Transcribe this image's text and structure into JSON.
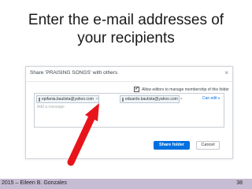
{
  "slide": {
    "title_line1": "Enter the e-mail addresses of",
    "title_line2": "your recipients"
  },
  "dialog": {
    "title": "Share 'PRAISING SONGS' with others",
    "close_glyph": "×",
    "allow_checked_glyph": "✔",
    "allow_label": "Allow editors to manage membership of this folder",
    "recipients": [
      {
        "email": "epifania.bautista@yahoo.com"
      },
      {
        "email": "eduardo.bautista@yahoo.com"
      }
    ],
    "chip_close_glyph": "×",
    "permission_label": "Can edit",
    "permission_chevron": "▾",
    "message_placeholder": "Add a message",
    "share_button": "Share folder",
    "cancel_button": "Cancel"
  },
  "annotation": {
    "arrow_color": "#e8141b"
  },
  "footer": {
    "left": "2015 – Eileen B. Gonzales",
    "page_number": "38",
    "background": "#c6bcd3"
  }
}
